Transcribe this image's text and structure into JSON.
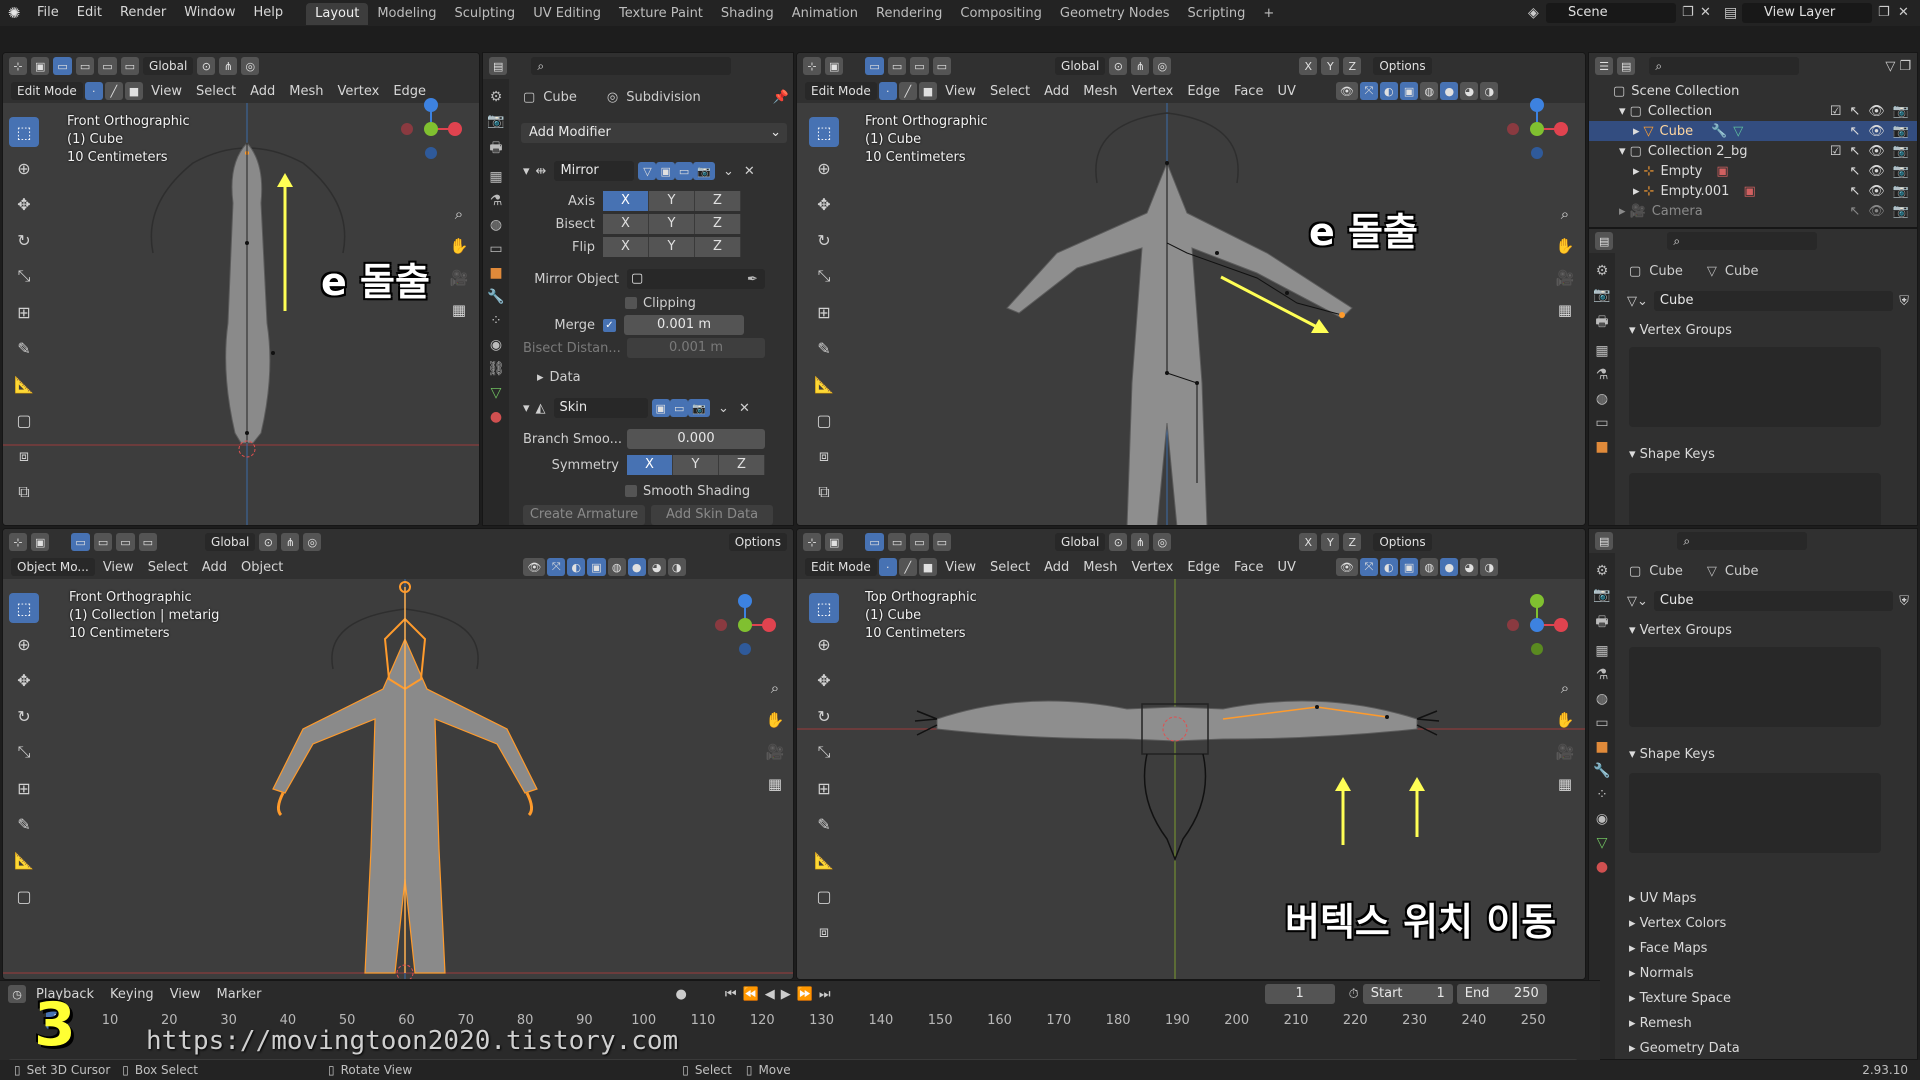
{
  "topbar": {
    "menus": [
      "File",
      "Edit",
      "Render",
      "Window",
      "Help"
    ],
    "workspaces": [
      "Layout",
      "Modeling",
      "Sculpting",
      "UV Editing",
      "Texture Paint",
      "Shading",
      "Animation",
      "Rendering",
      "Compositing",
      "Geometry Nodes",
      "Scripting"
    ],
    "active_workspace": "Layout",
    "scene": "Scene",
    "view_layer": "View Layer"
  },
  "viewports": {
    "top_left": {
      "mode": "Edit Mode",
      "menus": [
        "View",
        "Select",
        "Add",
        "Mesh",
        "Vertex",
        "Edge"
      ],
      "transform": "Global",
      "info": [
        "Front Orthographic",
        "(1) Cube",
        "10 Centimeters"
      ],
      "annotation": "e 돌출"
    },
    "top_right": {
      "mode": "Edit Mode",
      "menus": [
        "View",
        "Select",
        "Add",
        "Mesh",
        "Vertex",
        "Edge",
        "Face",
        "UV"
      ],
      "transform": "Global",
      "options": "Options",
      "xyz": [
        "X",
        "Y",
        "Z"
      ],
      "info": [
        "Front Orthographic",
        "(1) Cube",
        "10 Centimeters"
      ],
      "annotation": "e 돌출"
    },
    "bottom_left": {
      "mode": "Object Mo...",
      "menus": [
        "View",
        "Select",
        "Add",
        "Object"
      ],
      "transform": "Global",
      "options": "Options",
      "info": [
        "Front Orthographic",
        "(1) Collection | metarig",
        "10 Centimeters"
      ]
    },
    "bottom_right": {
      "mode": "Edit Mode",
      "menus": [
        "View",
        "Select",
        "Add",
        "Mesh",
        "Vertex",
        "Edge",
        "Face",
        "UV"
      ],
      "transform": "Global",
      "options": "Options",
      "xyz": [
        "X",
        "Y",
        "Z"
      ],
      "info": [
        "Top Orthographic",
        "(1) Cube",
        "10 Centimeters"
      ],
      "annotation": "버텍스 위치 이동"
    }
  },
  "modifiers": {
    "object": "Cube",
    "tab": "Subdivision",
    "add_modifier": "Add Modifier",
    "mirror": {
      "name": "Mirror",
      "axis_label": "Axis",
      "bisect_label": "Bisect",
      "flip_label": "Flip",
      "mirror_object_label": "Mirror Object",
      "clipping_label": "Clipping",
      "merge_label": "Merge",
      "merge_value": "0.001 m",
      "bisect_distance_label": "Bisect Distan...",
      "bisect_distance_value": "0.001 m",
      "data_label": "Data"
    },
    "skin": {
      "name": "Skin",
      "branch_label": "Branch Smoo...",
      "branch_value": "0.000",
      "symmetry_label": "Symmetry",
      "smooth_label": "Smooth Shading",
      "create_armature": "Create Armature",
      "add_skin_data": "Add Skin Data"
    },
    "xyz": [
      "X",
      "Y",
      "Z"
    ]
  },
  "outliner": {
    "rows": [
      {
        "label": "Scene Collection",
        "indent": 0
      },
      {
        "label": "Collection",
        "indent": 1
      },
      {
        "label": "Cube",
        "indent": 2
      },
      {
        "label": "Collection 2_bg",
        "indent": 1
      },
      {
        "label": "Empty",
        "indent": 2
      },
      {
        "label": "Empty.001",
        "indent": 2
      },
      {
        "label": "Camera",
        "indent": 1
      }
    ]
  },
  "data_props_top": {
    "object": "Cube",
    "mesh": "Cube",
    "mesh_field": "Cube",
    "vertex_groups": "Vertex Groups",
    "shape_keys": "Shape Keys"
  },
  "data_props_bottom": {
    "object": "Cube",
    "mesh": "Cube",
    "mesh_field": "Cube",
    "vertex_groups": "Vertex Groups",
    "shape_keys": "Shape Keys",
    "sections": [
      "UV Maps",
      "Vertex Colors",
      "Face Maps",
      "Normals",
      "Texture Space",
      "Remesh",
      "Geometry Data"
    ]
  },
  "timeline": {
    "menus": [
      "Playback",
      "Keying",
      "View",
      "Marker"
    ],
    "current_frame": "1",
    "start_label": "Start",
    "start": "1",
    "end_label": "End",
    "end": "250",
    "ticks": [
      "10",
      "20",
      "30",
      "40",
      "50",
      "60",
      "70",
      "80",
      "90",
      "100",
      "110",
      "120",
      "130",
      "140",
      "150",
      "160",
      "170",
      "180",
      "190",
      "200",
      "210",
      "220",
      "230",
      "240",
      "250"
    ]
  },
  "overlay": {
    "step_number": "3",
    "url": "https://movingtoon2020.tistory.com"
  },
  "status": {
    "set_cursor": "Set 3D Cursor",
    "box_select": "Box Select",
    "rotate_view": "Rotate View",
    "select": "Select",
    "move": "Move",
    "version": "2.93.10"
  },
  "colors": {
    "accent": "#4772b3",
    "selection": "#ffa033",
    "x_axis": "#e0434f",
    "y_axis": "#80c030",
    "z_axis": "#3d82e0"
  }
}
